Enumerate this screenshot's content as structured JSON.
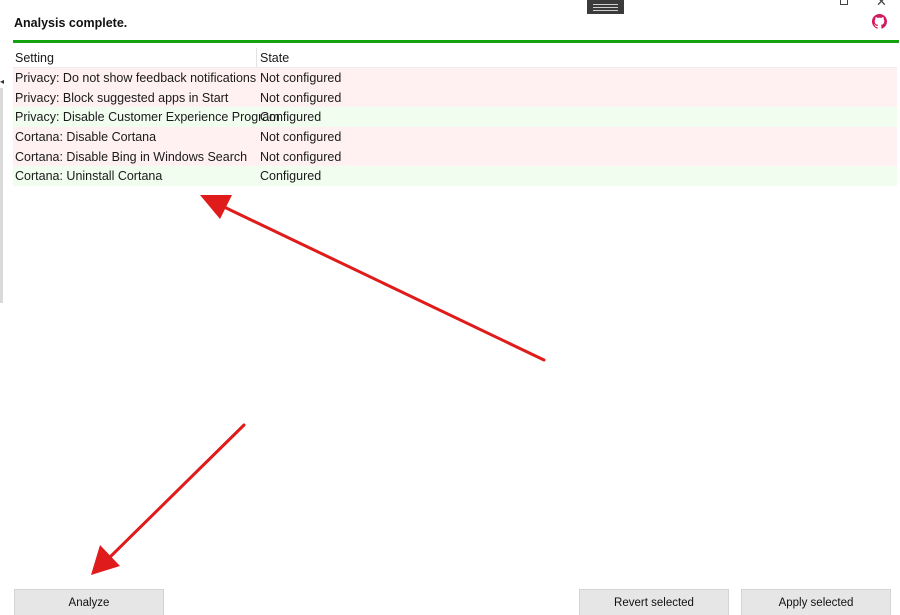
{
  "window": {
    "title": "Analysis complete."
  },
  "icons": {
    "github": "github-icon",
    "restore": "restore-icon",
    "close": "close-icon",
    "menu": "menu-handle-icon"
  },
  "colors": {
    "progress": "#13a10e",
    "not_configured_row": "#fff0f2",
    "configured_row": "#f1fdef",
    "github": "#d0195f",
    "annotation_arrow": "#e01b1b"
  },
  "grid": {
    "columns": [
      "Setting",
      "State"
    ],
    "rows": [
      {
        "setting": "Privacy: Do not show feedback notifications",
        "state": "Not configured"
      },
      {
        "setting": "Privacy: Block suggested apps in Start",
        "state": "Not configured"
      },
      {
        "setting": "Privacy: Disable Customer Experience Program",
        "state": "Configured"
      },
      {
        "setting": "Cortana: Disable Cortana",
        "state": "Not configured"
      },
      {
        "setting": "Cortana: Disable Bing in Windows Search",
        "state": "Not configured"
      },
      {
        "setting": "Cortana: Uninstall Cortana",
        "state": "Configured"
      }
    ]
  },
  "buttons": {
    "analyze": "Analyze",
    "revert": "Revert selected",
    "apply": "Apply selected"
  }
}
